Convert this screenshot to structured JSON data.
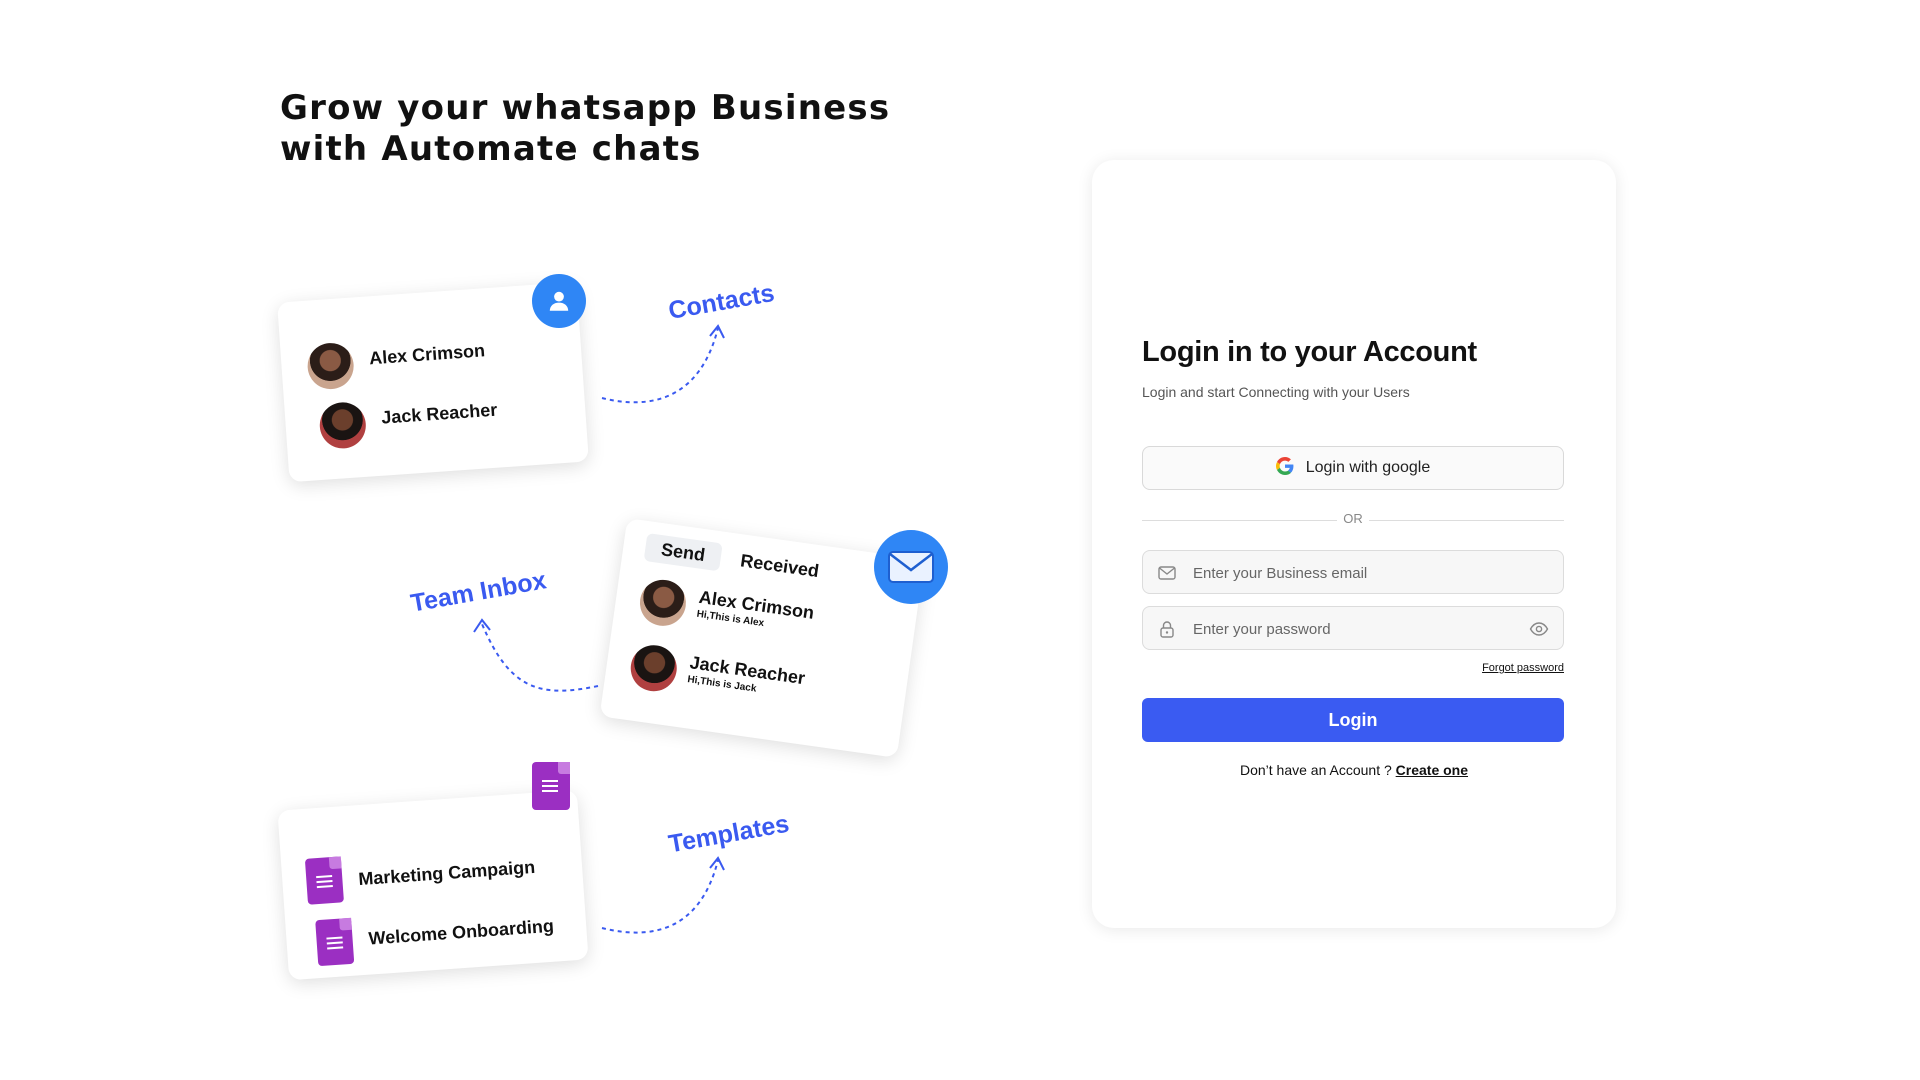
{
  "headline": {
    "line1": "Grow your whatsapp Business",
    "line2": "with Automate chats"
  },
  "contacts_card": {
    "label": "Contacts",
    "people": [
      {
        "name": "Alex Crimson"
      },
      {
        "name": "Jack Reacher"
      }
    ]
  },
  "inbox_card": {
    "label": "Team Inbox",
    "tabs": {
      "send": "Send",
      "received": "Received"
    },
    "messages": [
      {
        "name": "Alex Crimson",
        "preview": "Hi,This is Alex"
      },
      {
        "name": "Jack Reacher",
        "preview": "Hi,This is Jack"
      }
    ]
  },
  "templates_card": {
    "label": "Templates",
    "items": [
      {
        "name": "Marketing Campaign"
      },
      {
        "name": "Welcome Onboarding"
      }
    ]
  },
  "login": {
    "title": "Login in to your Account",
    "subtitle": "Login and start Connecting with your Users",
    "google_label": "Login with google",
    "or_label": "OR",
    "email_placeholder": "Enter your Business email",
    "password_placeholder": "Enter your password",
    "forgot_label": "Forgot password",
    "submit_label": "Login",
    "signup_prompt": "Don’t have an Account ?",
    "signup_link": "Create one"
  },
  "colors": {
    "accent": "#3a5bf2",
    "label_blue": "#3a5af0",
    "template_purple": "#9b2fc2",
    "badge_blue": "#2f86f5"
  },
  "icons": [
    "user-icon",
    "mail-icon",
    "document-icon",
    "google-icon",
    "envelope-icon",
    "lock-icon",
    "eye-icon"
  ]
}
